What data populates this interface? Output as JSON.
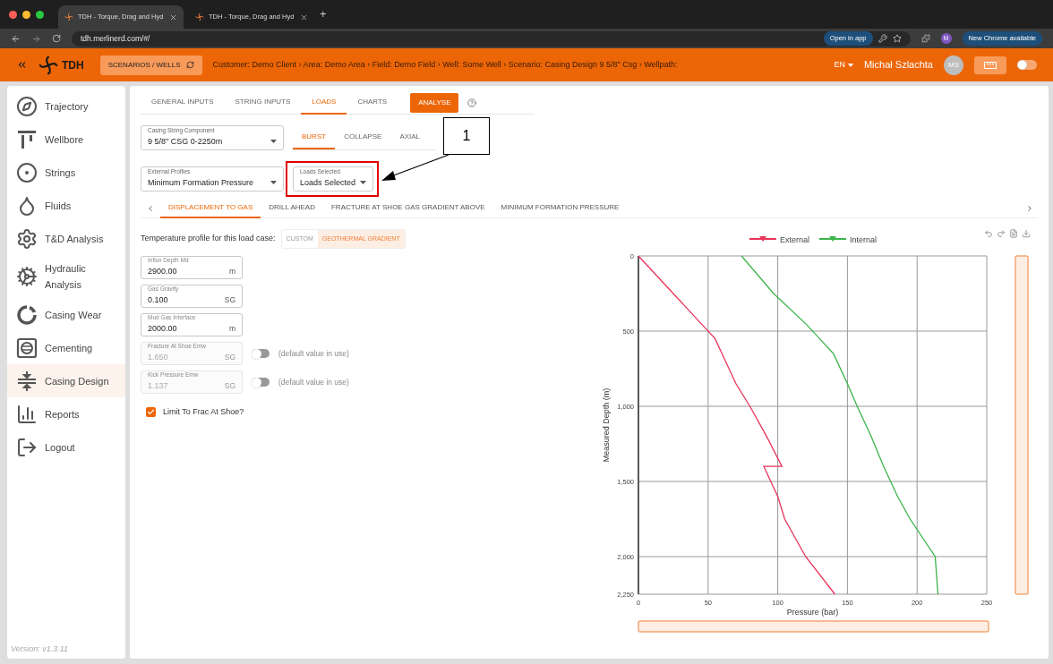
{
  "browser": {
    "tabs": [
      {
        "title": "TDH - Torque, Drag and Hyd",
        "selected": true
      },
      {
        "title": "TDH - Torque, Drag and Hyd",
        "selected": false
      }
    ],
    "new_tab": "+",
    "url": "tdh.merlinerd.com/#/",
    "open_in_app": "Open in app",
    "profile": "M",
    "update": "New Chrome available"
  },
  "header": {
    "logo": "TDH",
    "scenarios_button": "SCENARIOS / WELLS",
    "breadcrumb": "Customer: Demo Client › Area: Demo Area › Field: Demo Field › Well: Some Well › Scenario: Casing Design 9 5/8\" Csg › Wellpath:",
    "language": "EN",
    "user": "Michał Szlachta",
    "initials": "MS",
    "theme_toggle": {
      "on": false
    }
  },
  "sidebar": {
    "items": [
      {
        "label": "Trajectory",
        "kind": "trajectory",
        "selected": false
      },
      {
        "label": "Wellbore",
        "kind": "wellbore",
        "selected": false
      },
      {
        "label": "Strings",
        "kind": "strings",
        "selected": false
      },
      {
        "label": "Fluids",
        "kind": "fluids",
        "selected": false
      },
      {
        "label": "T&D Analysis",
        "kind": "td",
        "selected": false
      },
      {
        "label": "Hydraulic Analysis",
        "kind": "hydraulic",
        "selected": false
      },
      {
        "label": "Casing Wear",
        "kind": "wear",
        "selected": false
      },
      {
        "label": "Cementing",
        "kind": "cementing",
        "selected": false
      },
      {
        "label": "Casing Design",
        "kind": "casing",
        "selected": true
      },
      {
        "label": "Reports",
        "kind": "reports",
        "selected": false
      },
      {
        "label": "Logout",
        "kind": "logout",
        "selected": false
      }
    ],
    "version": "Version: v1.3.11"
  },
  "top_tabs": [
    {
      "label": "GENERAL INPUTS",
      "selected": false
    },
    {
      "label": "STRING INPUTS",
      "selected": false
    },
    {
      "label": "LOADS",
      "selected": true
    },
    {
      "label": "CHARTS",
      "selected": false
    }
  ],
  "analyse_button": "ANALYSE",
  "casing_component": {
    "label": "Casing String Component",
    "value": "9 5/8\" CSG 0-2250m"
  },
  "load_tabs": [
    {
      "label": "BURST",
      "selected": true
    },
    {
      "label": "COLLAPSE",
      "selected": false
    },
    {
      "label": "AXIAL",
      "selected": false
    }
  ],
  "external_profiles": {
    "label": "External Profiles",
    "value": "Minimum Formation Pressure"
  },
  "loads_selected": {
    "label": "Loads Selected",
    "value": "Loads Selected"
  },
  "callout": {
    "label": "1"
  },
  "load_cases": [
    {
      "label": "DISPLACEMENT TO GAS",
      "selected": true
    },
    {
      "label": "DRILL AHEAD",
      "selected": false
    },
    {
      "label": "FRACTURE AT SHOE GAS GRADIENT ABOVE",
      "selected": false
    },
    {
      "label": "MINIMUM FORMATION PRESSURE",
      "selected": false
    }
  ],
  "temperature": {
    "label": "Temperature profile for this load case:",
    "options": [
      {
        "label": "CUSTOM",
        "selected": false
      },
      {
        "label": "GEOTHERMAL GRADIENT",
        "selected": true
      }
    ]
  },
  "fields": [
    {
      "label": "Influx Depth Md",
      "value": "2900.00",
      "unit": "m",
      "disabled": false
    },
    {
      "label": "Gas Gravity",
      "value": "0.100",
      "unit": "SG",
      "disabled": false
    },
    {
      "label": "Mud Gas Interface",
      "value": "2000.00",
      "unit": "m",
      "disabled": false
    },
    {
      "label": "Fracture At Shoe Emw",
      "value": "1.650",
      "unit": "SG",
      "disabled": true,
      "toggle": {
        "on": false,
        "note": "(default value in use)"
      }
    },
    {
      "label": "Kick Pressure Emw",
      "value": "1.137",
      "unit": "SG",
      "disabled": true,
      "toggle": {
        "on": false,
        "note": "(default value in use)"
      }
    }
  ],
  "limit_checkbox": {
    "label": "Limit To Frac At Shoe?",
    "checked": true
  },
  "chart": {
    "chart_data": {
      "type": "line",
      "orientation": "horizontal",
      "xlabel": "Pressure (bar)",
      "ylabel": "Measured Depth (m)",
      "x": [
        0,
        250,
        450,
        550,
        650,
        850,
        1000,
        1200,
        1400,
        1400,
        1600,
        1750,
        2000,
        2250
      ],
      "series": [
        {
          "name": "External",
          "color": "#e8335a",
          "values": [
            0,
            25,
            45,
            55,
            60,
            70,
            80,
            92,
            103,
            90,
            100,
            105,
            120,
            141
          ]
        },
        {
          "name": "Internal",
          "color": "#3cb44b",
          "values": [
            74,
            97,
            120,
            130,
            140,
            150,
            157,
            167,
            176,
            176,
            186,
            195,
            213,
            215
          ]
        }
      ],
      "grid": true,
      "legend": "top",
      "xlim": [
        0,
        250
      ],
      "ylim": [
        2250,
        0
      ],
      "xticks": [
        0,
        50,
        100,
        150,
        200,
        250
      ],
      "yticks": [
        0,
        500,
        {
          "value": 1000,
          "label": "1,000"
        },
        {
          "value": 1500,
          "label": "1,500"
        },
        {
          "value": 2000,
          "label": "2,000"
        },
        {
          "value": 2250,
          "label": "2,250"
        }
      ]
    }
  }
}
